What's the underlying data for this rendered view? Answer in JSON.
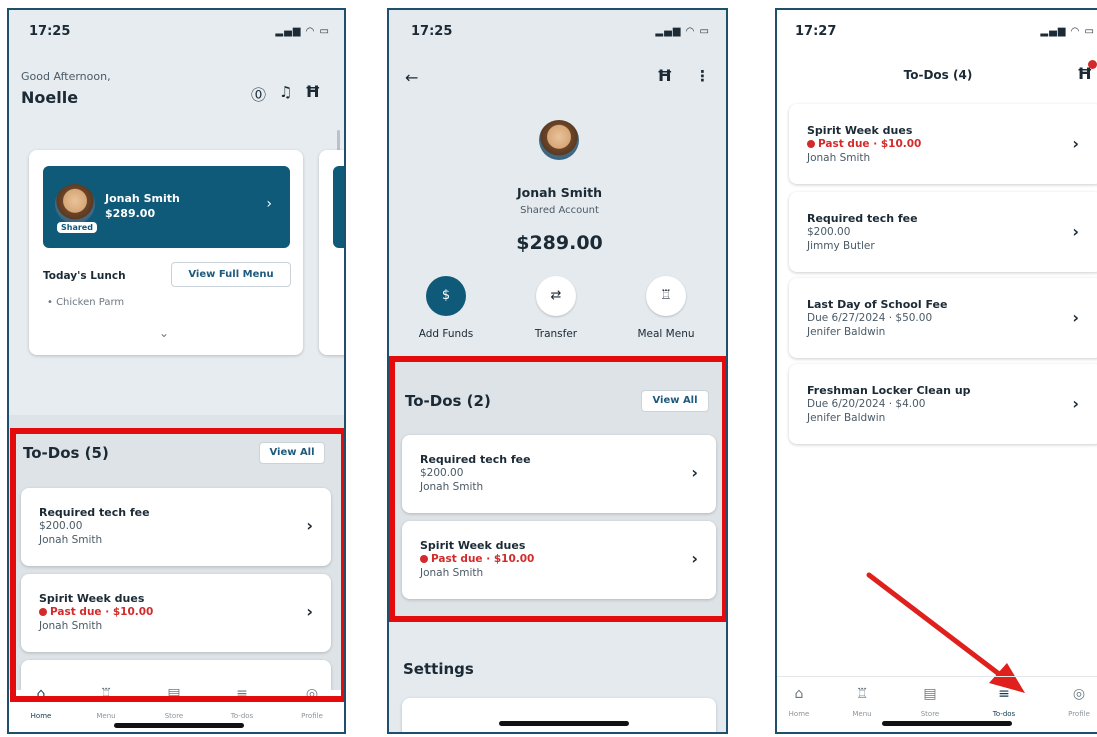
{
  "panel1": {
    "time": "17:25",
    "status_icons": "signal wifi battery",
    "greeting": "Good Afternoon,",
    "name": "Noelle",
    "student": {
      "name": "Jonah Smith",
      "balance": "$289.00",
      "badge": "Shared"
    },
    "lunch_label": "Today's Lunch",
    "view_full_menu": "View Full Menu",
    "lunch_item": "• Chicken Parm",
    "todos_title": "To-Dos (5)",
    "view_all": "View All",
    "todos": [
      {
        "title": "Required tech fee",
        "line1": "$200.00",
        "person": "Jonah Smith"
      },
      {
        "title": "Spirit Week dues",
        "past_due": "Past due · $10.00",
        "person": "Jonah Smith"
      }
    ],
    "nav": [
      {
        "label": "Home",
        "icon": "home-icon"
      },
      {
        "label": "Menu",
        "icon": "menu-icon"
      },
      {
        "label": "Store",
        "icon": "store-icon"
      },
      {
        "label": "To-dos",
        "icon": "todos-icon"
      },
      {
        "label": "Profile",
        "icon": "profile-icon"
      }
    ]
  },
  "panel2": {
    "time": "17:25",
    "student_name": "Jonah Smith",
    "account_type": "Shared Account",
    "balance": "$289.00",
    "actions": [
      {
        "label": "Add Funds",
        "icon": "dollar-icon"
      },
      {
        "label": "Transfer",
        "icon": "transfer-icon"
      },
      {
        "label": "Meal Menu",
        "icon": "meal-menu-icon"
      }
    ],
    "todos_title": "To-Dos (2)",
    "view_all": "View All",
    "todos": [
      {
        "title": "Required tech fee",
        "line1": "$200.00",
        "person": "Jonah Smith"
      },
      {
        "title": "Spirit Week dues",
        "past_due": "Past due · $10.00",
        "person": "Jonah Smith"
      }
    ],
    "settings_title": "Settings"
  },
  "panel3": {
    "time": "17:27",
    "title": "To-Dos (4)",
    "todos": [
      {
        "title": "Spirit Week dues",
        "past_due": "Past due · $10.00",
        "person": "Jonah Smith"
      },
      {
        "title": "Required tech fee",
        "line1": "$200.00",
        "person": "Jimmy Butler"
      },
      {
        "title": "Last Day of School Fee",
        "line1": "Due 6/27/2024 · $50.00",
        "person": "Jenifer Baldwin"
      },
      {
        "title": "Freshman Locker Clean up",
        "line1": "Due 6/20/2024 · $4.00",
        "person": "Jenifer Baldwin"
      }
    ],
    "nav": [
      {
        "label": "Home",
        "icon": "home-icon"
      },
      {
        "label": "Menu",
        "icon": "menu-icon"
      },
      {
        "label": "Store",
        "icon": "store-icon"
      },
      {
        "label": "To-dos",
        "icon": "todos-icon"
      },
      {
        "label": "Profile",
        "icon": "profile-icon"
      }
    ]
  },
  "colors": {
    "highlight": "#e30b0b",
    "brand_teal": "#0f5a78",
    "past_due": "#d22b2b",
    "annotation_arrow": "#e0201c"
  }
}
